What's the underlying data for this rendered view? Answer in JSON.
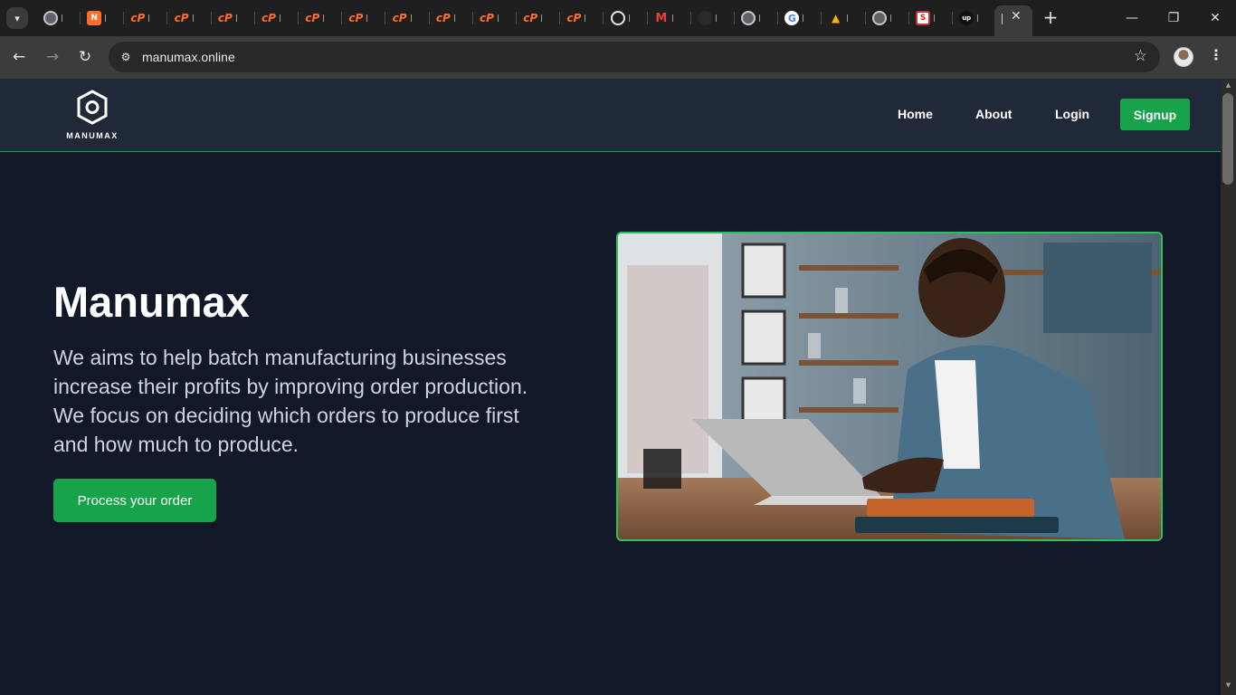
{
  "browser": {
    "url": "manumax.online",
    "tabs": [
      {
        "icon": "globe-icon",
        "glyph": ""
      },
      {
        "icon": "n-icon",
        "glyph": "N"
      },
      {
        "icon": "cpanel-icon",
        "glyph": "cP"
      },
      {
        "icon": "cpanel-icon",
        "glyph": "cP"
      },
      {
        "icon": "cpanel-icon",
        "glyph": "cP"
      },
      {
        "icon": "cpanel-icon",
        "glyph": "cP"
      },
      {
        "icon": "cpanel-icon",
        "glyph": "cP"
      },
      {
        "icon": "cpanel-icon",
        "glyph": "cP"
      },
      {
        "icon": "cpanel-icon",
        "glyph": "cP"
      },
      {
        "icon": "cpanel-icon",
        "glyph": "cP"
      },
      {
        "icon": "cpanel-icon",
        "glyph": "cP"
      },
      {
        "icon": "cpanel-icon",
        "glyph": "cP"
      },
      {
        "icon": "cpanel-icon",
        "glyph": "cP"
      },
      {
        "icon": "chatgpt-icon",
        "glyph": ""
      },
      {
        "icon": "gmail-icon",
        "glyph": "M"
      },
      {
        "icon": "dark-logo-icon",
        "glyph": ""
      },
      {
        "icon": "globe-icon",
        "glyph": ""
      },
      {
        "icon": "google-icon",
        "glyph": "G"
      },
      {
        "icon": "sun-icon",
        "glyph": "▲"
      },
      {
        "icon": "globe-icon",
        "glyph": ""
      },
      {
        "icon": "s-icon",
        "glyph": "S"
      },
      {
        "icon": "upwork-icon",
        "glyph": "up"
      }
    ]
  },
  "site": {
    "logo_text": "MANUMAX",
    "nav": {
      "home": "Home",
      "about": "About",
      "login": "Login",
      "signup": "Signup"
    },
    "hero": {
      "title": "Manumax",
      "description": "We aims to help batch manufacturing businesses increase their profits by improving order production. We focus on deciding which orders to produce first and how much to produce.",
      "cta": "Process your order"
    }
  },
  "colors": {
    "accent": "#16a34a",
    "page_bg": "#111827",
    "nav_bg": "#1f2937"
  }
}
